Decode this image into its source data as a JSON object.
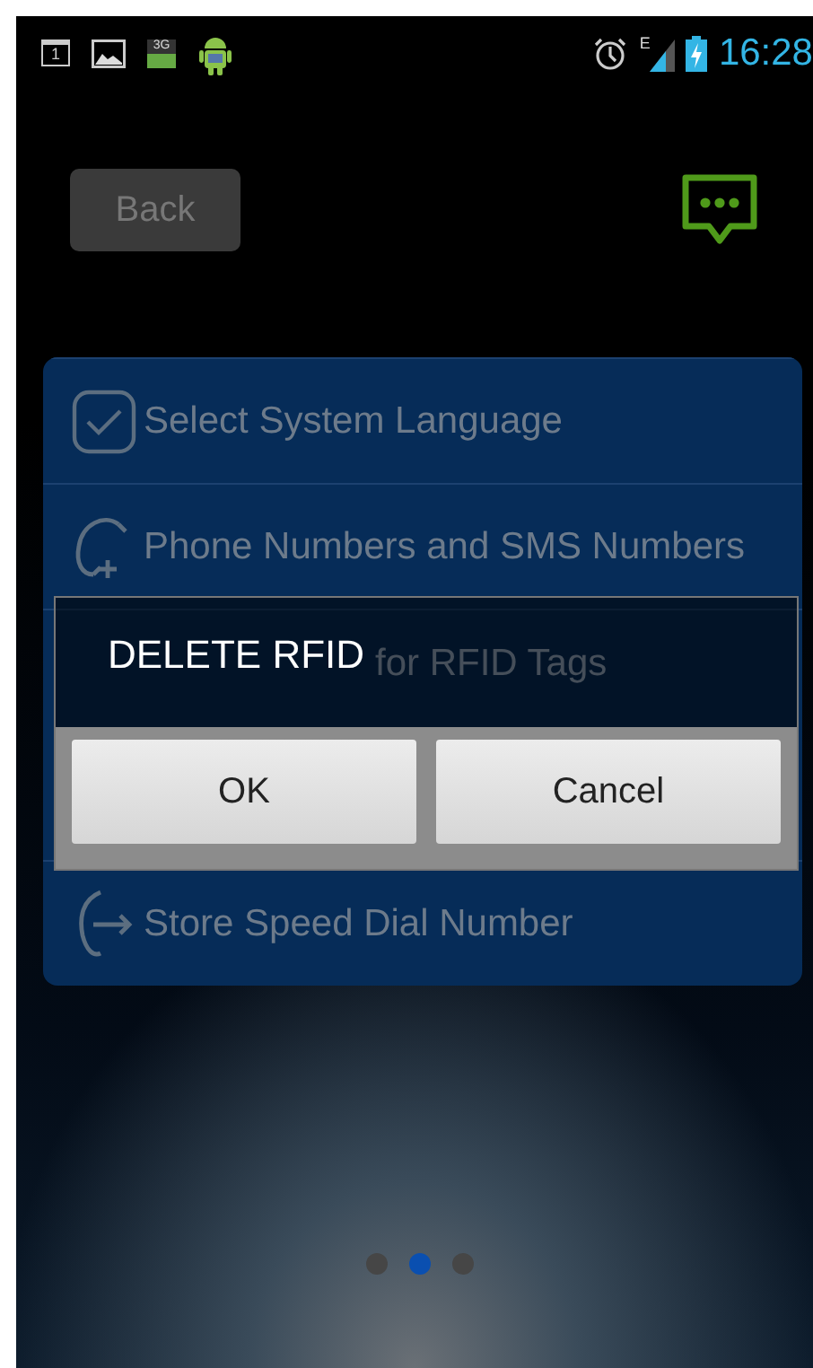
{
  "status_bar": {
    "calendar_day": "1",
    "network_badge": "3G",
    "signal_type": "E",
    "time": "16:28"
  },
  "top_bar": {
    "back_button": "Back"
  },
  "menu": {
    "items": [
      {
        "kind": "check",
        "label": "Select System Language"
      },
      {
        "kind": "phone-add",
        "label": "Phone Numbers and SMS Numbers"
      },
      {
        "kind": "covered",
        "label": "for RFID Tags"
      },
      {
        "kind": "phone-dial",
        "label": "Store Speed Dial Number"
      }
    ]
  },
  "dialog": {
    "title": "DELETE RFID",
    "buttons": [
      "OK",
      "Cancel"
    ]
  },
  "pages": [
    {
      "selected": false
    },
    {
      "selected": true
    },
    {
      "selected": false
    }
  ]
}
